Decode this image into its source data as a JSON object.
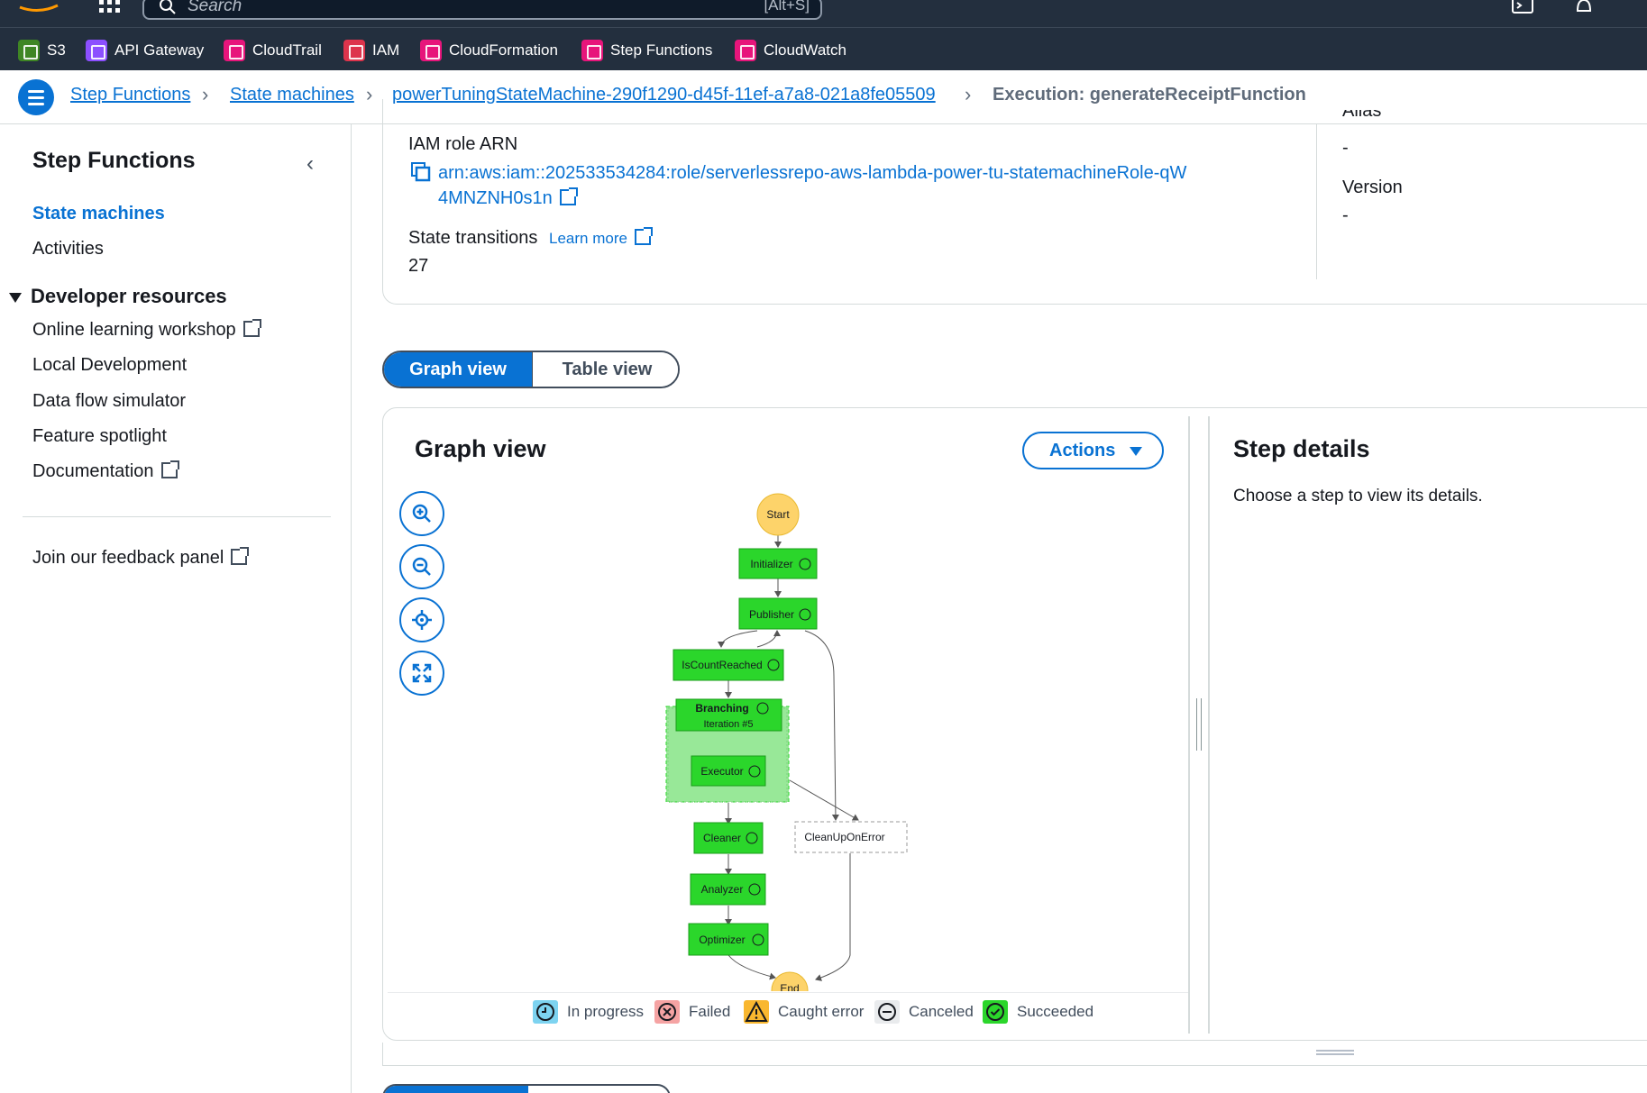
{
  "header": {
    "search_placeholder": "Search",
    "search_shortcut": "[Alt+S]"
  },
  "favorites": [
    {
      "label": "S3",
      "color": "#3f8624"
    },
    {
      "label": "API Gateway",
      "color": "#8c4fff"
    },
    {
      "label": "CloudTrail",
      "color": "#e7157b"
    },
    {
      "label": "IAM",
      "color": "#dd344c"
    },
    {
      "label": "CloudFormation",
      "color": "#e7157b"
    },
    {
      "label": "Step Functions",
      "color": "#e7157b"
    },
    {
      "label": "CloudWatch",
      "color": "#e7157b"
    }
  ],
  "breadcrumb": {
    "items": [
      "Step Functions",
      "State machines",
      "powerTuningStateMachine-290f1290-d45f-11ef-a7a8-021a8fe05509"
    ],
    "current": "Execution: generateReceiptFunction"
  },
  "sidebar": {
    "title": "Step Functions",
    "items": [
      "State machines",
      "Activities"
    ],
    "section": "Developer resources",
    "resources": [
      "Online learning workshop",
      "Local Development",
      "Data flow simulator",
      "Feature spotlight",
      "Documentation"
    ],
    "feedback": "Join our feedback panel"
  },
  "details": {
    "iam_label": "IAM role ARN",
    "iam_arn": "arn:aws:iam::202533534284:role/serverlessrepo-aws-lambda-power-tu-statemachineRole-qW4MNZNH0s1n",
    "transitions_label": "State transitions",
    "learn_more": "Learn more",
    "transitions_value": "27",
    "alias_label": "Alias",
    "alias_value": "-",
    "version_label": "Version",
    "version_value": "-"
  },
  "view_toggle": {
    "graph": "Graph view",
    "table": "Table view"
  },
  "graph": {
    "title": "Graph view",
    "actions": "Actions",
    "nodes": {
      "start": "Start",
      "initializer": "Initializer",
      "publisher": "Publisher",
      "iscount": "IsCountReached",
      "branching": "Branching",
      "iteration": "Iteration #5",
      "executor": "Executor",
      "cleaner": "Cleaner",
      "analyzer": "Analyzer",
      "optimizer": "Optimizer",
      "cleanup": "CleanUpOnError",
      "end": "End"
    },
    "legend": [
      {
        "label": "In progress",
        "color": "#7dd3f0"
      },
      {
        "label": "Failed",
        "color": "#f5a3a3"
      },
      {
        "label": "Caught error",
        "color": "#f9b72f"
      },
      {
        "label": "Canceled",
        "color": "#e9ebed"
      },
      {
        "label": "Succeeded",
        "color": "#2bd62b"
      }
    ]
  },
  "step_details": {
    "title": "Step details",
    "text": "Choose a step to view its details."
  }
}
